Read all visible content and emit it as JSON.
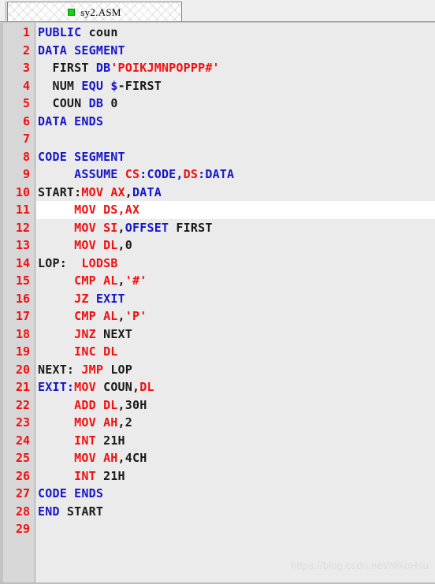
{
  "window": {
    "tab": {
      "label": "sy2.ASM",
      "icon": "green-square-icon",
      "active": true
    }
  },
  "editor": {
    "language": "assembly",
    "active_line": 11,
    "total_lines": 29,
    "colors": {
      "keyword": "#1616c8",
      "instruction": "#f01010",
      "string": "#f01010",
      "identifier": "#1a1a1a",
      "line_number": "#f01010",
      "background": "#ebebeb",
      "active_line_background": "#ffffff",
      "gutter_background": "#d7d7d7"
    },
    "lines": [
      {
        "n": "1",
        "tokens": [
          {
            "t": "PUBLIC",
            "c": "key"
          },
          {
            "t": " coun",
            "c": "id"
          }
        ]
      },
      {
        "n": "2",
        "tokens": [
          {
            "t": "DATA SEGMENT",
            "c": "key"
          }
        ]
      },
      {
        "n": "3",
        "tokens": [
          {
            "t": "  FIRST ",
            "c": "id"
          },
          {
            "t": "DB",
            "c": "key"
          },
          {
            "t": "'POIKJMNPOPPP#'",
            "c": "str"
          }
        ]
      },
      {
        "n": "4",
        "tokens": [
          {
            "t": "  NUM ",
            "c": "id"
          },
          {
            "t": "EQU",
            "c": "key"
          },
          {
            "t": " ",
            "c": "id"
          },
          {
            "t": "$",
            "c": "key"
          },
          {
            "t": "-FIRST",
            "c": "id"
          }
        ]
      },
      {
        "n": "5",
        "tokens": [
          {
            "t": "  COUN ",
            "c": "id"
          },
          {
            "t": "DB",
            "c": "key"
          },
          {
            "t": " 0",
            "c": "id"
          }
        ]
      },
      {
        "n": "6",
        "tokens": [
          {
            "t": "DATA ENDS",
            "c": "key"
          }
        ]
      },
      {
        "n": "7",
        "tokens": []
      },
      {
        "n": "8",
        "tokens": [
          {
            "t": "CODE SEGMENT",
            "c": "key"
          }
        ]
      },
      {
        "n": "9",
        "tokens": [
          {
            "t": "     ASSUME ",
            "c": "key"
          },
          {
            "t": "CS",
            "c": "ins"
          },
          {
            "t": ":CODE,",
            "c": "key"
          },
          {
            "t": "DS",
            "c": "ins"
          },
          {
            "t": ":DATA",
            "c": "key"
          }
        ]
      },
      {
        "n": "10",
        "tokens": [
          {
            "t": "START:",
            "c": "id"
          },
          {
            "t": "MOV AX",
            "c": "ins"
          },
          {
            "t": ",",
            "c": "id"
          },
          {
            "t": "DATA",
            "c": "key"
          }
        ]
      },
      {
        "n": "11",
        "tokens": [
          {
            "t": "     ",
            "c": "id"
          },
          {
            "t": "MOV DS,AX",
            "c": "ins"
          }
        ]
      },
      {
        "n": "12",
        "tokens": [
          {
            "t": "     ",
            "c": "id"
          },
          {
            "t": "MOV SI",
            "c": "ins"
          },
          {
            "t": ",",
            "c": "id"
          },
          {
            "t": "OFFSET",
            "c": "key"
          },
          {
            "t": " FIRST",
            "c": "id"
          }
        ]
      },
      {
        "n": "13",
        "tokens": [
          {
            "t": "     ",
            "c": "id"
          },
          {
            "t": "MOV DL",
            "c": "ins"
          },
          {
            "t": ",0",
            "c": "id"
          }
        ]
      },
      {
        "n": "14",
        "tokens": [
          {
            "t": "LOP:  ",
            "c": "id"
          },
          {
            "t": "LODSB",
            "c": "ins"
          }
        ]
      },
      {
        "n": "15",
        "tokens": [
          {
            "t": "     ",
            "c": "id"
          },
          {
            "t": "CMP AL",
            "c": "ins"
          },
          {
            "t": ",",
            "c": "id"
          },
          {
            "t": "'#'",
            "c": "str"
          }
        ]
      },
      {
        "n": "16",
        "tokens": [
          {
            "t": "     ",
            "c": "id"
          },
          {
            "t": "JZ",
            "c": "ins"
          },
          {
            "t": " ",
            "c": "id"
          },
          {
            "t": "EXIT",
            "c": "key"
          }
        ]
      },
      {
        "n": "17",
        "tokens": [
          {
            "t": "     ",
            "c": "id"
          },
          {
            "t": "CMP AL",
            "c": "ins"
          },
          {
            "t": ",",
            "c": "id"
          },
          {
            "t": "'P'",
            "c": "str"
          }
        ]
      },
      {
        "n": "18",
        "tokens": [
          {
            "t": "     ",
            "c": "id"
          },
          {
            "t": "JNZ",
            "c": "ins"
          },
          {
            "t": " NEXT",
            "c": "id"
          }
        ]
      },
      {
        "n": "19",
        "tokens": [
          {
            "t": "     ",
            "c": "id"
          },
          {
            "t": "INC DL",
            "c": "ins"
          }
        ]
      },
      {
        "n": "20",
        "tokens": [
          {
            "t": "NEXT: ",
            "c": "id"
          },
          {
            "t": "JMP",
            "c": "ins"
          },
          {
            "t": " LOP",
            "c": "id"
          }
        ]
      },
      {
        "n": "21",
        "tokens": [
          {
            "t": "EXIT:",
            "c": "key"
          },
          {
            "t": "MOV",
            "c": "ins"
          },
          {
            "t": " COUN,",
            "c": "id"
          },
          {
            "t": "DL",
            "c": "ins"
          }
        ]
      },
      {
        "n": "22",
        "tokens": [
          {
            "t": "     ",
            "c": "id"
          },
          {
            "t": "ADD DL",
            "c": "ins"
          },
          {
            "t": ",30H",
            "c": "id"
          }
        ]
      },
      {
        "n": "23",
        "tokens": [
          {
            "t": "     ",
            "c": "id"
          },
          {
            "t": "MOV AH",
            "c": "ins"
          },
          {
            "t": ",2",
            "c": "id"
          }
        ]
      },
      {
        "n": "24",
        "tokens": [
          {
            "t": "     ",
            "c": "id"
          },
          {
            "t": "INT",
            "c": "ins"
          },
          {
            "t": " 21H",
            "c": "id"
          }
        ]
      },
      {
        "n": "25",
        "tokens": [
          {
            "t": "     ",
            "c": "id"
          },
          {
            "t": "MOV AH",
            "c": "ins"
          },
          {
            "t": ",4CH",
            "c": "id"
          }
        ]
      },
      {
        "n": "26",
        "tokens": [
          {
            "t": "     ",
            "c": "id"
          },
          {
            "t": "INT",
            "c": "ins"
          },
          {
            "t": " 21H",
            "c": "id"
          }
        ]
      },
      {
        "n": "27",
        "tokens": [
          {
            "t": "CODE ENDS",
            "c": "key"
          }
        ]
      },
      {
        "n": "28",
        "tokens": [
          {
            "t": "END",
            "c": "key"
          },
          {
            "t": " START",
            "c": "id"
          }
        ]
      },
      {
        "n": "29",
        "tokens": []
      }
    ]
  },
  "watermark": {
    "text": "https://blog.csdn.net/NikoHsu"
  }
}
